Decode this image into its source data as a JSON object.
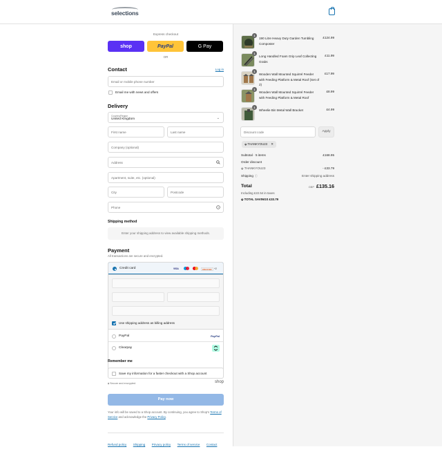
{
  "brand": {
    "name": "selections"
  },
  "express": {
    "label": "Express checkout",
    "shop": "shop",
    "paypal": "PayPal",
    "gpay": "G Pay",
    "or": "OR"
  },
  "contact": {
    "title": "Contact",
    "login": "Log in",
    "email_placeholder": "Email or mobile phone number",
    "newsletter": "Email me with news and offers"
  },
  "delivery": {
    "title": "Delivery",
    "country_label": "Country/Region",
    "country_value": "United Kingdom",
    "first_name": "First name",
    "last_name": "Last name",
    "company": "Company (optional)",
    "address": "Address",
    "apartment": "Apartment, suite, etc. (optional)",
    "city": "City",
    "postcode": "Postcode",
    "phone": "Phone"
  },
  "shipping": {
    "title": "Shipping method",
    "notice": "Enter your shipping address to view available shipping methods."
  },
  "payment": {
    "title": "Payment",
    "subtitle": "All transactions are secure and encrypted.",
    "credit_card": "Credit card",
    "brands": [
      "VISA",
      "MC",
      "MC",
      "DISCOVER",
      "+2"
    ],
    "billing_same": "Use shipping address as billing address",
    "paypal": "PayPal",
    "paypal_logo": "PayPal",
    "clearpay": "Clearpay"
  },
  "remember": {
    "title": "Remember me",
    "save_info": "Save my information for a faster checkout with a Shop account",
    "secure": "Secure and encrypted",
    "shop_logo": "shop"
  },
  "pay_button": "Pay now",
  "legal": {
    "text1": "Your info will be saved to a Shop account. By continuing, you agree to Shop's",
    "terms": "Terms of Service",
    "and": "and acknowledge the",
    "privacy": "Privacy Policy",
    "end": "."
  },
  "footer": [
    "Refund policy",
    "Shipping",
    "Privacy policy",
    "Terms of service",
    "Contact"
  ],
  "cart": {
    "items": [
      {
        "name": "190 Litre Heavy Duty Garden Tumbling Composter",
        "price": "£124.99",
        "qty": "1"
      },
      {
        "name": "Long Handled Foam Grip Leaf Collecting Grabs",
        "price": "£11.99",
        "qty": "1"
      },
      {
        "name": "Wooden Wall Mounted Squirrel Feeder with Feeding Platform & Metal Roof (Set of 2)",
        "price": "£17.99",
        "qty": "1"
      },
      {
        "name": "Wooden Wall Mounted Squirrel Feeder with Feeding Platform & Metal Roof",
        "price": "£8.99",
        "qty": "1"
      },
      {
        "name": "Wheelie Bin Metal Wall Bracket",
        "price": "£4.99",
        "qty": "1"
      }
    ],
    "discount_placeholder": "Discount code",
    "apply": "Apply",
    "applied_code": "THANKYOU23",
    "subtotal_label": "Subtotal · 5 items",
    "subtotal": "£168.95",
    "order_discount_label": "Order discount",
    "discount_code": "THANKYOU23",
    "discount_value": "- £33.79",
    "shipping_label": "Shipping",
    "shipping_value": "Enter shipping address",
    "total_label": "Total",
    "currency": "GBP",
    "total": "£135.16",
    "taxes": "Including £22.54 in taxes",
    "savings_label": "TOTAL SAVINGS",
    "savings": "£33.79"
  },
  "colors": {
    "accent": "#1773b0",
    "shop": "#5a31f4",
    "paypal": "#ffc439",
    "pay_button": "#93b8e6"
  }
}
